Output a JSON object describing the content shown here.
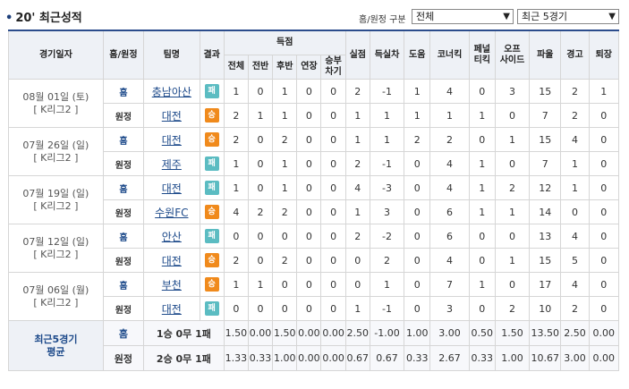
{
  "header": {
    "title": "20' 최근성적",
    "filter_label": "홈/원정 구분",
    "filter_value": "전체",
    "range_value": "최근 5경기"
  },
  "columns": {
    "date": "경기일자",
    "ha": "홈/원정",
    "team": "팀명",
    "result": "결과",
    "goals_group": "득점",
    "goals_sub": [
      "전체",
      "전반",
      "후반",
      "연장",
      "승부\n차기"
    ],
    "stats": [
      "실점",
      "득실차",
      "도움",
      "코너킥",
      "페널\n티킥",
      "오프\n사이드",
      "파울",
      "경고",
      "퇴장"
    ]
  },
  "matches": [
    {
      "date": "08월 01일 (토)",
      "league": "[ K리그2 ]",
      "rows": [
        {
          "ha": "홈",
          "team": "충남아산",
          "result": "패",
          "type": "lose",
          "cells": [
            "1",
            "0",
            "1",
            "0",
            "0",
            "2",
            "-1",
            "1",
            "4",
            "0",
            "3",
            "15",
            "2",
            "1"
          ]
        },
        {
          "ha": "원정",
          "team": "대전",
          "result": "승",
          "type": "win",
          "cells": [
            "2",
            "1",
            "1",
            "0",
            "0",
            "1",
            "1",
            "1",
            "1",
            "1",
            "0",
            "7",
            "2",
            "0"
          ]
        }
      ]
    },
    {
      "date": "07월 26일 (일)",
      "league": "[ K리그2 ]",
      "rows": [
        {
          "ha": "홈",
          "team": "대전",
          "result": "승",
          "type": "win",
          "cells": [
            "2",
            "0",
            "2",
            "0",
            "0",
            "1",
            "1",
            "2",
            "2",
            "0",
            "1",
            "15",
            "4",
            "0"
          ]
        },
        {
          "ha": "원정",
          "team": "제주",
          "result": "패",
          "type": "lose",
          "cells": [
            "1",
            "0",
            "1",
            "0",
            "0",
            "2",
            "-1",
            "0",
            "4",
            "1",
            "0",
            "7",
            "1",
            "0"
          ]
        }
      ]
    },
    {
      "date": "07월 19일 (일)",
      "league": "[ K리그2 ]",
      "rows": [
        {
          "ha": "홈",
          "team": "대전",
          "result": "패",
          "type": "lose",
          "cells": [
            "1",
            "0",
            "1",
            "0",
            "0",
            "4",
            "-3",
            "0",
            "4",
            "1",
            "2",
            "12",
            "1",
            "0"
          ]
        },
        {
          "ha": "원정",
          "team": "수원FC",
          "result": "승",
          "type": "win",
          "cells": [
            "4",
            "2",
            "2",
            "0",
            "0",
            "1",
            "3",
            "0",
            "6",
            "1",
            "1",
            "14",
            "0",
            "0"
          ]
        }
      ]
    },
    {
      "date": "07월 12일 (일)",
      "league": "[ K리그2 ]",
      "rows": [
        {
          "ha": "홈",
          "team": "안산",
          "result": "패",
          "type": "lose",
          "cells": [
            "0",
            "0",
            "0",
            "0",
            "0",
            "2",
            "-2",
            "0",
            "6",
            "0",
            "0",
            "13",
            "4",
            "0"
          ]
        },
        {
          "ha": "원정",
          "team": "대전",
          "result": "승",
          "type": "win",
          "cells": [
            "2",
            "0",
            "2",
            "0",
            "0",
            "0",
            "2",
            "0",
            "4",
            "0",
            "1",
            "15",
            "5",
            "0"
          ]
        }
      ]
    },
    {
      "date": "07월 06일 (월)",
      "league": "[ K리그2 ]",
      "rows": [
        {
          "ha": "홈",
          "team": "부천",
          "result": "승",
          "type": "win",
          "cells": [
            "1",
            "1",
            "0",
            "0",
            "0",
            "0",
            "1",
            "0",
            "7",
            "1",
            "0",
            "17",
            "4",
            "0"
          ]
        },
        {
          "ha": "원정",
          "team": "대전",
          "result": "패",
          "type": "lose",
          "cells": [
            "0",
            "0",
            "0",
            "0",
            "0",
            "1",
            "-1",
            "0",
            "3",
            "0",
            "2",
            "10",
            "2",
            "0"
          ]
        }
      ]
    }
  ],
  "average": {
    "label_line1": "최근5경기",
    "label_line2": "평균",
    "rows": [
      {
        "ha": "홈",
        "record": "1승 0무 1패",
        "cells": [
          "1.50",
          "0.00",
          "1.50",
          "0.00",
          "0.00",
          "2.50",
          "-1.00",
          "1.00",
          "3.00",
          "0.50",
          "1.50",
          "13.50",
          "2.50",
          "0.00"
        ]
      },
      {
        "ha": "원정",
        "record": "2승 0무 1패",
        "cells": [
          "1.33",
          "0.33",
          "1.00",
          "0.00",
          "0.00",
          "0.67",
          "0.67",
          "0.33",
          "2.67",
          "0.33",
          "1.00",
          "10.67",
          "3.00",
          "0.00"
        ]
      }
    ]
  }
}
